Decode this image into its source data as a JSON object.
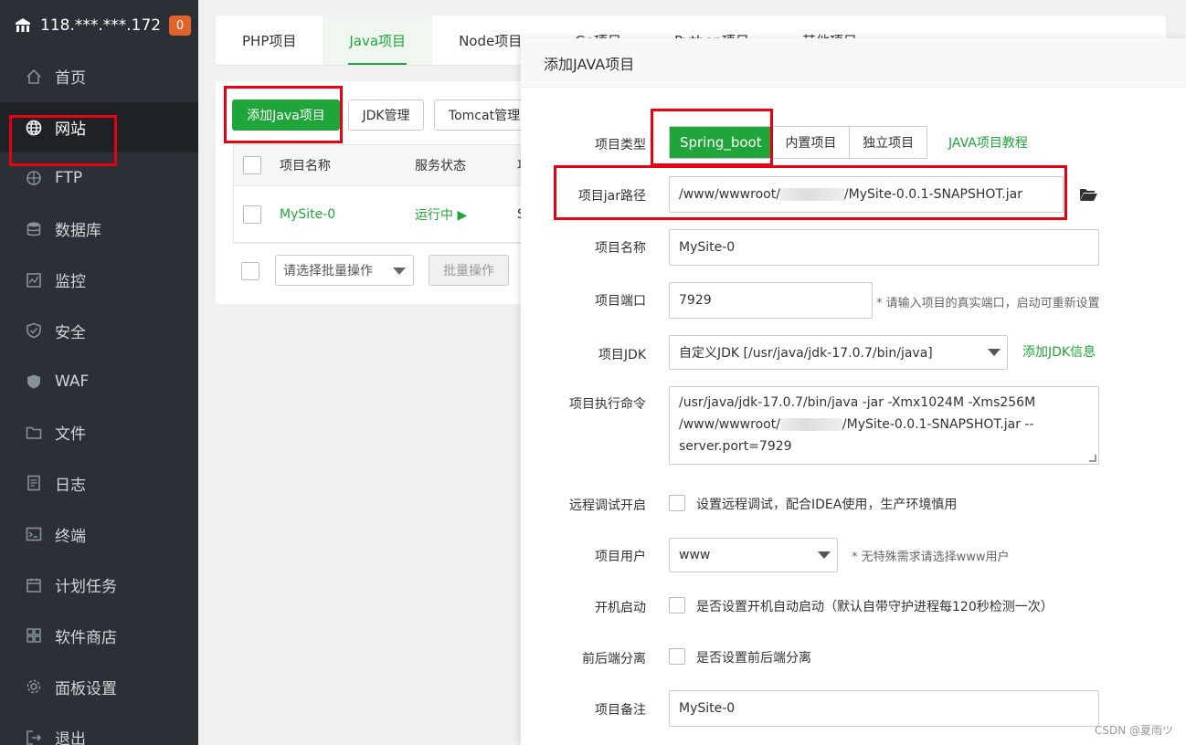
{
  "sidebar": {
    "host": "118.***.***.172",
    "badge": "0",
    "items": [
      {
        "label": "首页",
        "icon": "home-icon"
      },
      {
        "label": "网站",
        "icon": "globe-icon"
      },
      {
        "label": "FTP",
        "icon": "ftp-icon"
      },
      {
        "label": "数据库",
        "icon": "database-icon"
      },
      {
        "label": "监控",
        "icon": "monitor-icon"
      },
      {
        "label": "安全",
        "icon": "shield-icon"
      },
      {
        "label": "WAF",
        "icon": "waf-shield-icon"
      },
      {
        "label": "文件",
        "icon": "folder-icon"
      },
      {
        "label": "日志",
        "icon": "log-icon"
      },
      {
        "label": "终端",
        "icon": "terminal-icon"
      },
      {
        "label": "计划任务",
        "icon": "calendar-icon"
      },
      {
        "label": "软件商店",
        "icon": "apps-grid-icon"
      },
      {
        "label": "面板设置",
        "icon": "gear-icon"
      },
      {
        "label": "退出",
        "icon": "logout-icon"
      }
    ]
  },
  "tabs": [
    "PHP项目",
    "Java项目",
    "Node项目",
    "Go项目",
    "Python项目",
    "其他项目"
  ],
  "toolbar": {
    "add_java": "添加Java项目",
    "jdk": "JDK管理",
    "tomcat": "Tomcat管理"
  },
  "table": {
    "headers": {
      "name": "项目名称",
      "status": "服务状态",
      "extra": "项"
    },
    "rows": [
      {
        "name": "MySite-0",
        "status": "运行中 ▶",
        "extra": "S"
      }
    ]
  },
  "batch": {
    "select_placeholder": "请选择批量操作",
    "apply": "批量操作"
  },
  "dialog": {
    "title": "添加JAVA项目",
    "type_label": "项目类型",
    "types": [
      "Spring_boot",
      "内置项目",
      "独立项目"
    ],
    "tutorial_link": "JAVA项目教程",
    "jar_label": "项目jar路径",
    "jar_prefix": "/www/wwwroot/",
    "jar_suffix": "/MySite-0.0.1-SNAPSHOT.jar",
    "name_label": "项目名称",
    "name_value": "MySite-0",
    "port_label": "项目端口",
    "port_value": "7929",
    "port_hint": "* 请输入项目的真实端口，启动可重新设置",
    "jdk_label": "项目JDK",
    "jdk_value": "自定义JDK [/usr/java/jdk-17.0.7/bin/java]",
    "add_jdk_link": "添加JDK信息",
    "cmd_label": "项目执行命令",
    "cmd_line1": "/usr/java/jdk-17.0.7/bin/java -jar -Xmx1024M -Xms256M",
    "cmd_line2_prefix": "/www/wwwroot/",
    "cmd_line2_suffix": "/MySite-0.0.1-SNAPSHOT.jar --",
    "cmd_line3": "server.port=7929",
    "debug_label": "远程调试开启",
    "debug_text": "设置远程调试，配合IDEA使用，生产环境慎用",
    "user_label": "项目用户",
    "user_value": "www",
    "user_hint": "* 无特殊需求请选择www用户",
    "boot_label": "开机启动",
    "boot_text": "是否设置开机自动启动（默认自带守护进程每120秒检测一次）",
    "sep_label": "前后端分离",
    "sep_text": "是否设置前后端分离",
    "remark_label": "项目备注",
    "remark_value": "MySite-0"
  },
  "watermark": "CSDN @夏雨ツ",
  "colors": {
    "accent": "#20a53a",
    "sidebar_bg": "#2b3036",
    "highlight": "#e60012",
    "badge": "#e0632b"
  }
}
